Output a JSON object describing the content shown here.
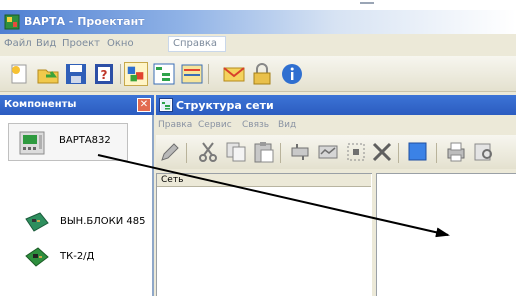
{
  "app": {
    "title": "ВАРТА - Проектант",
    "menu": [
      "Файл",
      "Вид",
      "Проект",
      "Окно",
      "Справка"
    ],
    "toolbar_icons": [
      "new-icon",
      "open-icon",
      "save-icon",
      "help-book-icon",
      "components-icon",
      "tree-icon",
      "table-icon",
      "mail-icon",
      "lock-icon",
      "info-icon"
    ]
  },
  "components_panel": {
    "title": "Компоненты",
    "close_label": "✕",
    "items": [
      {
        "label": "ВАРТА832",
        "icon": "device-icon"
      },
      {
        "label": "ВЫН.БЛОКИ 485",
        "icon": "board-icon"
      },
      {
        "label": "ТК-2/Д",
        "icon": "board-icon"
      }
    ]
  },
  "network_window": {
    "title": "Структура сети",
    "menu": [
      "Правка",
      "Сервис",
      "Связь",
      "Вид"
    ],
    "toolbar_icons": [
      "edit-icon",
      "cut-icon",
      "copy-icon",
      "paste-icon",
      "add-device-icon",
      "add-line-icon",
      "select-icon",
      "delete-icon",
      "color-icon",
      "print-icon",
      "preview-icon"
    ],
    "tree_header": "Сеть"
  }
}
